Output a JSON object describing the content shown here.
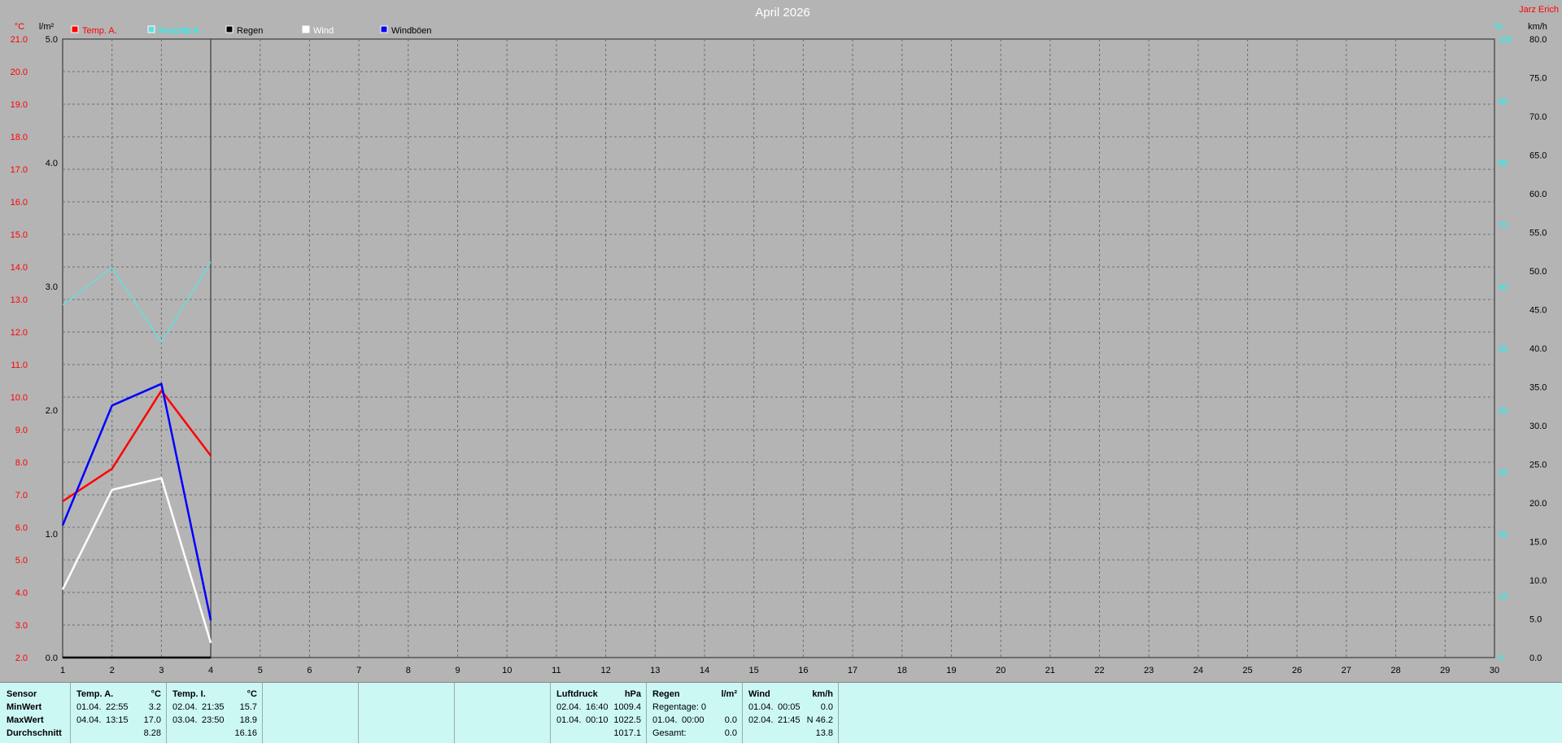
{
  "chart_data": {
    "type": "line",
    "title": "April 2026",
    "author": "Jarz Erich",
    "x": [
      1,
      2,
      3,
      4
    ],
    "xlim": [
      1,
      30
    ],
    "x_ticks": [
      1,
      2,
      3,
      4,
      5,
      6,
      7,
      8,
      9,
      10,
      11,
      12,
      13,
      14,
      15,
      16,
      17,
      18,
      19,
      20,
      21,
      22,
      23,
      24,
      25,
      26,
      27,
      28,
      29,
      30
    ],
    "axes": {
      "temp": {
        "unit": "°C",
        "ylim": [
          2.0,
          21.0
        ],
        "step": 1.0,
        "color": "#ff0000"
      },
      "rain": {
        "unit": "l/m²",
        "ylim": [
          0.0,
          5.0
        ],
        "step": 1.0,
        "color": "#000000"
      },
      "humidity": {
        "unit": "%",
        "ylim": [
          0,
          100
        ],
        "step": 10,
        "color": "#00ffff"
      },
      "wind": {
        "unit": "km/h",
        "ylim": [
          0.0,
          80.0
        ],
        "step": 5.0,
        "color": "#000000"
      }
    },
    "series": [
      {
        "name": "Temp. A.",
        "axis": "temp",
        "color": "#ff0000",
        "values": [
          6.8,
          7.8,
          10.2,
          8.2
        ]
      },
      {
        "name": "Feuchte A.",
        "axis": "humidity",
        "color": "#66dddd",
        "values": [
          57,
          63,
          51,
          64
        ]
      },
      {
        "name": "Regen",
        "axis": "rain",
        "color": "#000000",
        "values": [
          0.0,
          0.0,
          0.0,
          0.0
        ]
      },
      {
        "name": "Wind",
        "axis": "wind",
        "color": "#ffffff",
        "values": [
          8.8,
          21.7,
          23.2,
          1.9
        ]
      },
      {
        "name": "Windböen",
        "axis": "wind",
        "color": "#0000ff",
        "values": [
          17.1,
          32.6,
          35.4,
          4.8
        ]
      }
    ],
    "grid": true,
    "legend_placement": "top-left"
  },
  "stats": {
    "sensor": {
      "header": "Sensor",
      "min": "MinWert",
      "max": "MaxWert",
      "avg": "Durchschnitt"
    },
    "temp_a": {
      "header": "Temp. A.",
      "unit": "°C",
      "min_date": "01.04.",
      "min_time": "22:55",
      "min_val": "3.2",
      "max_date": "04.04.",
      "max_time": "13:15",
      "max_val": "17.0",
      "avg": "8.28"
    },
    "temp_i": {
      "header": "Temp. I.",
      "unit": "°C",
      "min_date": "02.04.",
      "min_time": "21:35",
      "min_val": "15.7",
      "max_date": "03.04.",
      "max_time": "23:50",
      "max_val": "18.9",
      "avg": "16.16"
    },
    "pressure": {
      "header": "Luftdruck",
      "unit": "hPa",
      "min_date": "02.04.",
      "min_time": "16:40",
      "min_val": "1009.4",
      "max_date": "01.04.",
      "max_time": "00:10",
      "max_val": "1022.5",
      "avg": "1017.1"
    },
    "rain": {
      "header": "Regen",
      "unit": "l/m²",
      "days_label": "Regentage: 0",
      "max_date": "01.04.",
      "max_time": "00:00",
      "max_val": "0.0",
      "total_label": "Gesamt:",
      "total_val": "0.0"
    },
    "wind": {
      "header": "Wind",
      "unit": "km/h",
      "min_date": "01.04.",
      "min_time": "00:05",
      "min_val": "0.0",
      "max_date": "02.04.",
      "max_time": "21:45",
      "max_val": "N 46.2",
      "avg": "13.8"
    }
  }
}
